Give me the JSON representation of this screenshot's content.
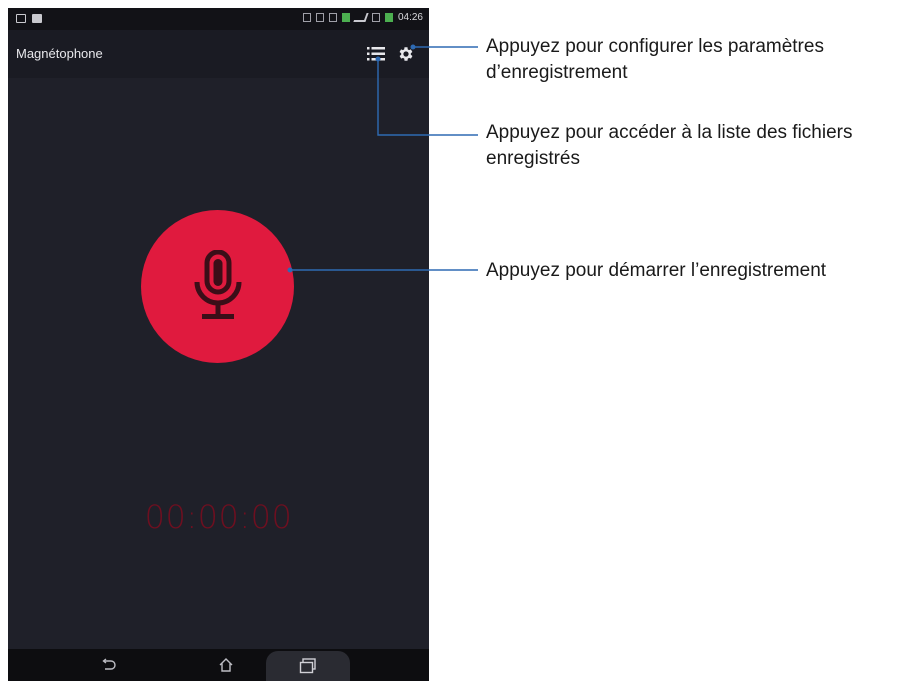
{
  "status_bar": {
    "time": "04:26"
  },
  "app_bar": {
    "title": "Magnétophone",
    "list_icon": "list-icon",
    "settings_icon": "gear-icon"
  },
  "recorder": {
    "record_icon": "microphone-icon",
    "timer": "00:00:00"
  },
  "nav_bar": {
    "back_icon": "back-icon",
    "home_icon": "home-icon",
    "recent_icon": "recent-apps-icon"
  },
  "callouts": {
    "settings_line1": "Appuyez pour configurer les paramètres",
    "settings_line2": "d’enregistrement",
    "list_line1": "Appuyez pour accéder à la liste des fichiers",
    "list_line2": "enregistrés",
    "record": "Appuyez pour démarrer l’enregistrement"
  },
  "colors": {
    "record_red": "#e01a3e",
    "background": "#1f2029",
    "leader_line": "#2e6ab3"
  }
}
